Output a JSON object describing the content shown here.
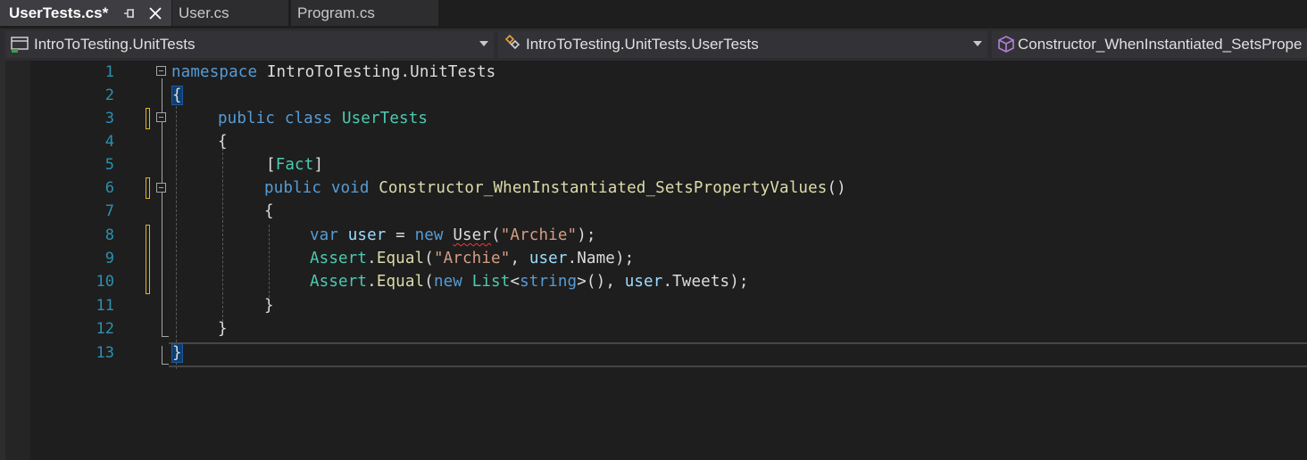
{
  "tabs": [
    {
      "label": "UserTests.cs*",
      "active": true
    },
    {
      "label": "User.cs",
      "active": false
    },
    {
      "label": "Program.cs",
      "active": false
    }
  ],
  "navbar": {
    "project": "IntroToTesting.UnitTests",
    "class": "IntroToTesting.UnitTests.UserTests",
    "member": "Constructor_WhenInstantiated_SetsPrope"
  },
  "editor": {
    "line_numbers": [
      "1",
      "2",
      "3",
      "4",
      "5",
      "6",
      "7",
      "8",
      "9",
      "10",
      "11",
      "12",
      "13"
    ],
    "tokens": {
      "namespace_kw": "namespace",
      "namespace_name": " IntroToTesting.UnitTests",
      "open_brace": "{",
      "close_brace": "}",
      "public_kw": "public",
      "class_kw": "class",
      "class_name": "UserTests",
      "attr_open": "[",
      "attr_name": "Fact",
      "attr_close": "]",
      "void_kw": "void",
      "method_name": "Constructor_WhenInstantiated_SetsPropertyValues",
      "parens": "()",
      "var_kw": "var",
      "user_var": "user",
      "assign": " = ",
      "new_kw": "new",
      "user_type": "User",
      "paren_open": "(",
      "archie_str": "\"Archie\"",
      "close_stmt": ");",
      "assert_type": "Assert",
      "dot": ".",
      "equal_method": "Equal",
      "comma": ", ",
      "name_prop": "Name",
      "list_type": "List",
      "lt": "<",
      "string_kw": "string",
      "gt_parens": ">()",
      "tweets_prop": "Tweets"
    }
  },
  "colors": {
    "keyword": "#569cd6",
    "type": "#4ec9b0",
    "string": "#d69d85",
    "line_number": "#2b91af",
    "change_marker": "#e6b422"
  },
  "icons": {
    "project": "csharp-project-icon",
    "class": "class-icon",
    "member": "method-cube-icon",
    "pin": "pin-icon",
    "close": "close-icon"
  }
}
